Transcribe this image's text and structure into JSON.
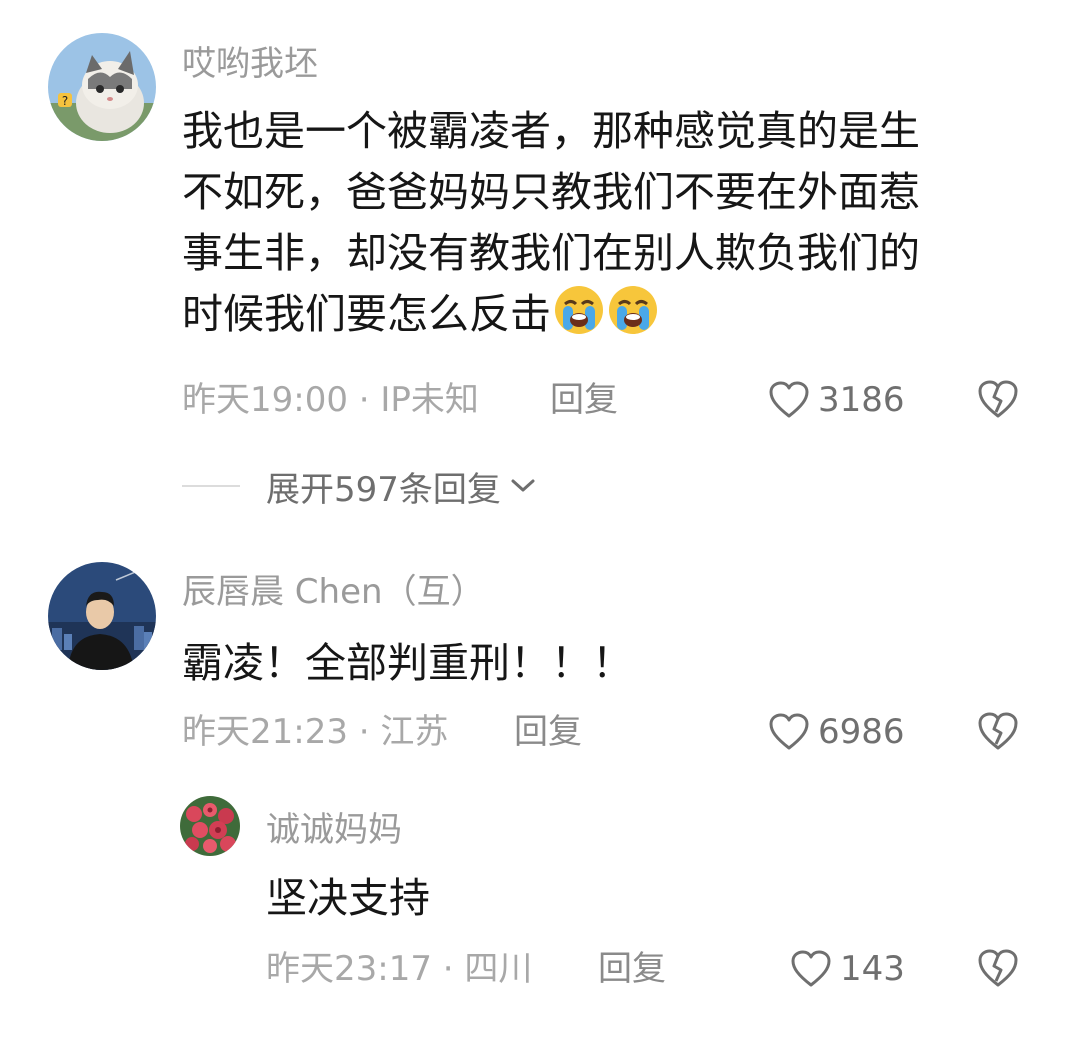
{
  "comments": [
    {
      "username": "哎哟我坯",
      "lines": [
        "我也是一个被霸凌者，那种感觉真的是生",
        "不如死，爸爸妈妈只教我们不要在外面惹",
        "事生非，却没有教我们在别人欺负我们的",
        "时候我们要怎么反击"
      ],
      "emojis": [
        "loudly-crying-face-icon",
        "loudly-crying-face-icon"
      ],
      "meta": "昨天19:00 · IP未知",
      "reply_label": "回复",
      "like_count": "3186",
      "expand_label": "展开597条回复"
    },
    {
      "username": "辰唇晨 Chen（互）",
      "text": "霸凌！全部判重刑！！！",
      "meta": "昨天21:23 · 江苏",
      "reply_label": "回复",
      "like_count": "6986"
    },
    {
      "username": "诚诚妈妈",
      "text": "坚决支持",
      "meta": "昨天23:17 · 四川",
      "reply_label": "回复",
      "like_count": "143"
    }
  ],
  "icons": {
    "like": "heart-outline-icon",
    "dislike": "broken-heart-icon",
    "expand": "chevron-down-icon"
  },
  "colors": {
    "text": "#161616",
    "username": "#9a9a9a",
    "meta": "#a8a8a8",
    "icon": "#6f6f6f"
  }
}
